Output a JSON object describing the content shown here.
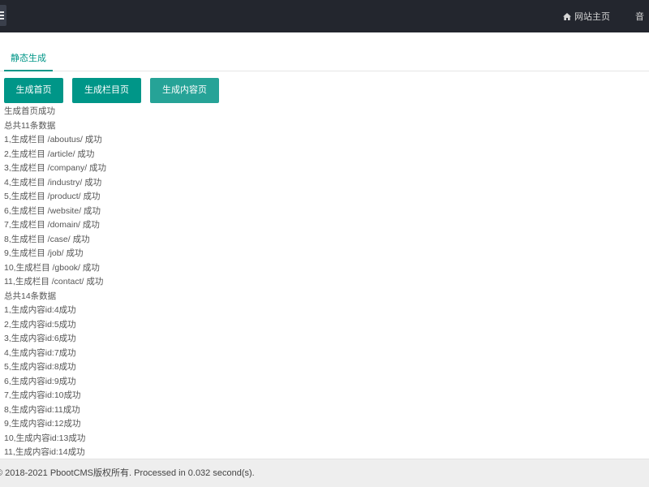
{
  "topbar": {
    "nav_home_label": "网站主页",
    "nav_cut_label": "音"
  },
  "tabs": {
    "active_label": "静态生成"
  },
  "buttons": {
    "index_label": "生成首页",
    "columns_label": "生成栏目页",
    "content_label": "生成内容页"
  },
  "log": [
    "生成首页成功",
    "总共11条数据",
    "1,生成栏目 /aboutus/ 成功",
    "2,生成栏目 /article/ 成功",
    "3,生成栏目 /company/ 成功",
    "4,生成栏目 /industry/ 成功",
    "5,生成栏目 /product/ 成功",
    "6,生成栏目 /website/ 成功",
    "7,生成栏目 /domain/ 成功",
    "8,生成栏目 /case/ 成功",
    "9,生成栏目 /job/ 成功",
    "10,生成栏目 /gbook/ 成功",
    "11,生成栏目 /contact/ 成功",
    "总共14条数据",
    "1,生成内容id:4成功",
    "2,生成内容id:5成功",
    "3,生成内容id:6成功",
    "4,生成内容id:7成功",
    "5,生成内容id:8成功",
    "6,生成内容id:9成功",
    "7,生成内容id:10成功",
    "8,生成内容id:11成功",
    "9,生成内容id:12成功",
    "10,生成内容id:13成功",
    "11,生成内容id:14成功"
  ],
  "footer": {
    "text": "© 2018-2021 PbootCMS版权所有. Processed in 0.032 second(s)."
  },
  "icons": {
    "menu": "hamburger-icon",
    "home": "home-icon"
  },
  "colors": {
    "topbar": "#23262e",
    "accent": "#009688"
  }
}
